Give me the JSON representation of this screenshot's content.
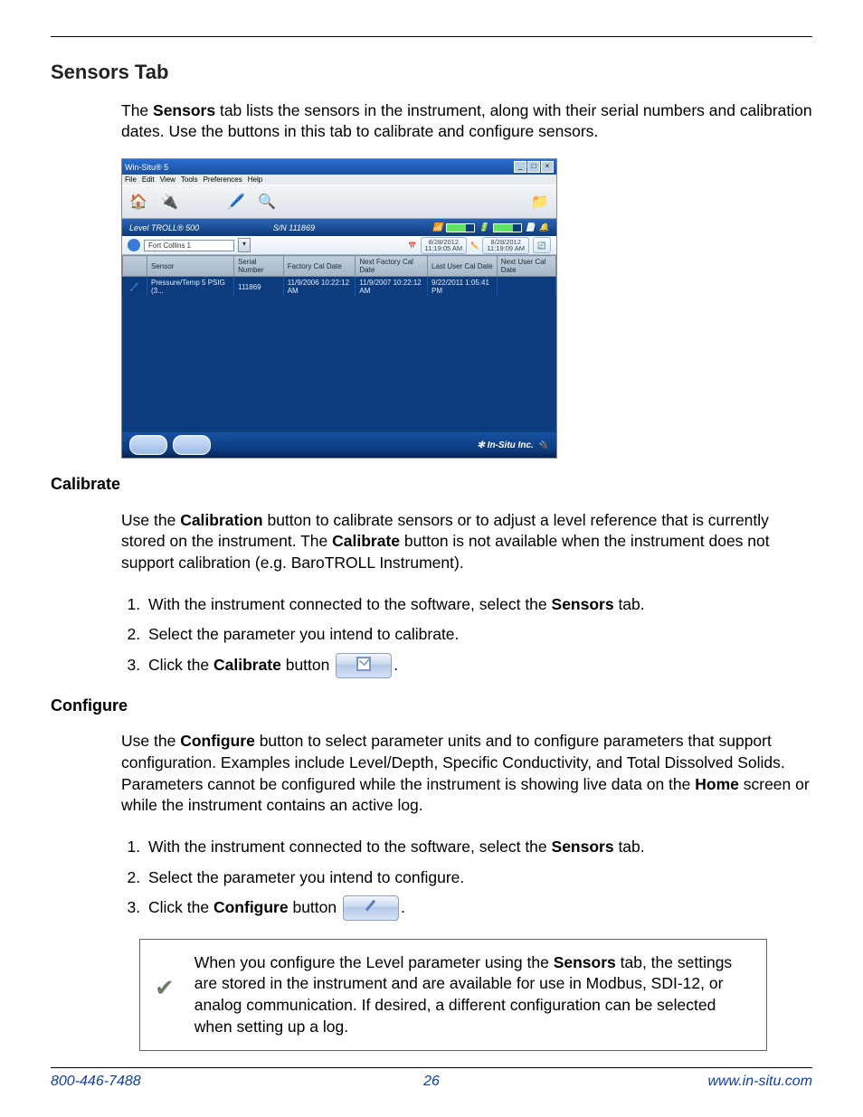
{
  "section_title": "Sensors Tab",
  "intro": {
    "pre": "The ",
    "b1": "Sensors",
    "post": " tab lists the sensors in the instrument, along with their serial numbers and calibration dates. Use the buttons in this tab to calibrate and configure sensors."
  },
  "app": {
    "title": "Win-Situ® 5",
    "menus": [
      "File",
      "Edit",
      "View",
      "Tools",
      "Preferences",
      "Help"
    ],
    "toolbar_icons": [
      "home-icon",
      "connect-icon",
      "sensors-icon",
      "view-icon",
      "folder-icon"
    ],
    "device_model": "Level TROLL® 500",
    "serial_number_label": "S/N 111869",
    "site_label": "Fort Collins 1",
    "clocks": {
      "left": {
        "date": "8/28/2012",
        "time": "11:19:05 AM"
      },
      "right": {
        "date": "8/28/2012",
        "time": "11:19:09 AM"
      }
    },
    "columns": [
      "Sensor",
      "Serial Number",
      "Factory Cal Date",
      "Next Factory Cal Date",
      "Last User Cal Date",
      "Next User Cal Date"
    ],
    "row": {
      "sensor": "Pressure/Temp 5 PSIG (3...",
      "serial": "111869",
      "factory_cal": "11/9/2006 10:22:12 AM",
      "next_factory_cal": "11/9/2007 10:22:12 AM",
      "last_user_cal": "9/22/2011 1:05:41 PM",
      "next_user_cal": ""
    },
    "status_buttons": [
      "calibrate-icon",
      "configure-icon"
    ],
    "brand": "In-Situ Inc."
  },
  "calibrate_heading": "Calibrate",
  "calibrate_para": {
    "pre": "Use the ",
    "b1": "Calibration",
    "mid1": " button to calibrate sensors or to adjust a level reference that is currently stored on the instrument. The ",
    "b2": "Calibrate",
    "post": " button is not available when the instrument does not support calibration (e.g. BaroTROLL Instrument)."
  },
  "calibrate_steps": {
    "s1a": "With the instrument connected to the software, select the ",
    "s1b": "Sensors",
    "s1c": " tab.",
    "s2": "Select the parameter you intend to calibrate.",
    "s3a": "Click the ",
    "s3b": "Calibrate",
    "s3c": " button ",
    "s3d": "."
  },
  "configure_heading": "Configure",
  "configure_para": {
    "pre": "Use the ",
    "b1": "Configure",
    "mid1": " button to select parameter units and to configure parameters that support configuration. Examples include Level/Depth, Specific Conductivity, and Total Dissolved Solids. Parameters cannot be configured while the instrument is showing live data on the ",
    "b2": "Home",
    "post": " screen or while the instrument contains an active log."
  },
  "configure_steps": {
    "s1a": "With the instrument connected to the software, select the ",
    "s1b": "Sensors",
    "s1c": " tab.",
    "s2": "Select the parameter you intend to configure.",
    "s3a": "Click the ",
    "s3b": "Configure",
    "s3c": " button ",
    "s3d": "."
  },
  "note": {
    "pre": "When you configure the Level parameter using the ",
    "b1": "Sensors",
    "post": " tab, the settings are stored in the instrument and are available for use in Modbus, SDI-12, or analog communication. If desired, a different configuration can be selected when setting up a log."
  },
  "footer": {
    "phone": "800-446-7488",
    "page": "26",
    "url": "www.in-situ.com"
  }
}
